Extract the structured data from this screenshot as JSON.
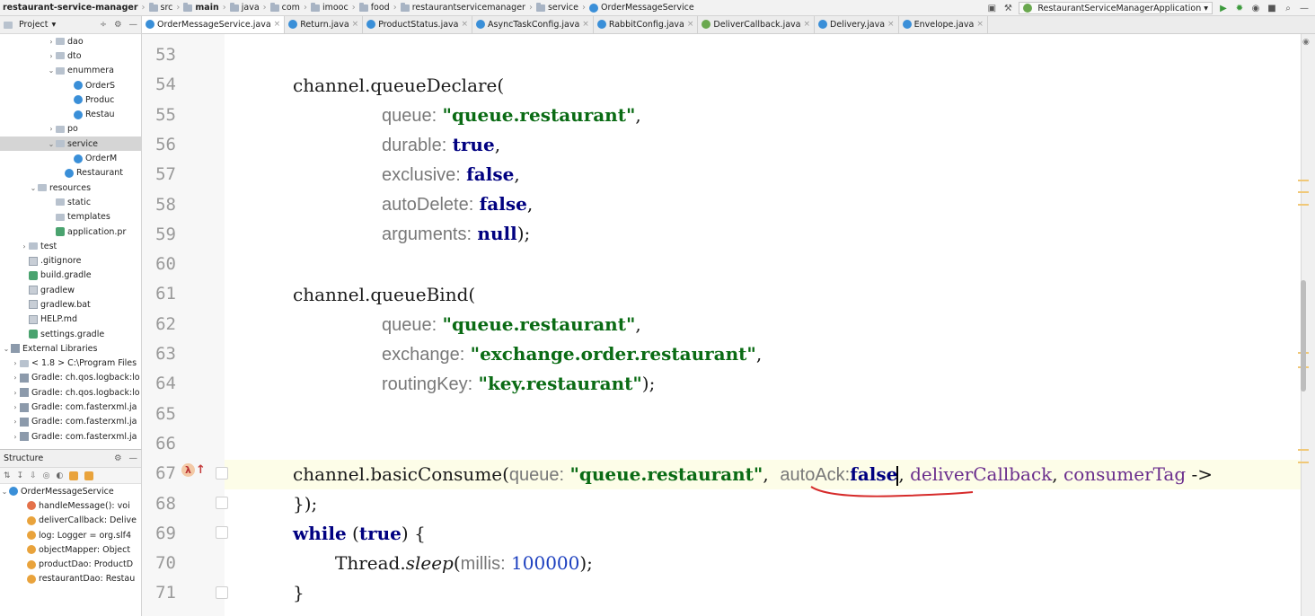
{
  "breadcrumb": {
    "items": [
      "restaurant-service-manager",
      "src",
      "main",
      "java",
      "com",
      "imooc",
      "food",
      "restaurantservicemanager",
      "service",
      "OrderMessageService"
    ]
  },
  "toolbar": {
    "run_config": "RestaurantServiceManagerApplication"
  },
  "project": {
    "header": "Project",
    "tree": [
      {
        "label": "dao",
        "indent": 5,
        "arrow": "›",
        "icon": "folder"
      },
      {
        "label": "dto",
        "indent": 5,
        "arrow": "›",
        "icon": "folder"
      },
      {
        "label": "enummera",
        "indent": 5,
        "arrow": "⌄",
        "icon": "folder"
      },
      {
        "label": "OrderS",
        "indent": 7,
        "arrow": "",
        "icon": "enum"
      },
      {
        "label": "Produc",
        "indent": 7,
        "arrow": "",
        "icon": "enum"
      },
      {
        "label": "Restau",
        "indent": 7,
        "arrow": "",
        "icon": "enum"
      },
      {
        "label": "po",
        "indent": 5,
        "arrow": "›",
        "icon": "folder"
      },
      {
        "label": "service",
        "indent": 5,
        "arrow": "⌄",
        "icon": "folder",
        "selected": true
      },
      {
        "label": "OrderM",
        "indent": 7,
        "arrow": "",
        "icon": "class"
      },
      {
        "label": "Restaurant",
        "indent": 6,
        "arrow": "",
        "icon": "class"
      },
      {
        "label": "resources",
        "indent": 3,
        "arrow": "⌄",
        "icon": "folder"
      },
      {
        "label": "static",
        "indent": 5,
        "arrow": "",
        "icon": "folder"
      },
      {
        "label": "templates",
        "indent": 5,
        "arrow": "",
        "icon": "folder"
      },
      {
        "label": "application.pr",
        "indent": 5,
        "arrow": "",
        "icon": "gradle"
      },
      {
        "label": "test",
        "indent": 2,
        "arrow": "›",
        "icon": "folder"
      },
      {
        "label": ".gitignore",
        "indent": 2,
        "arrow": "",
        "icon": "file"
      },
      {
        "label": "build.gradle",
        "indent": 2,
        "arrow": "",
        "icon": "gradle"
      },
      {
        "label": "gradlew",
        "indent": 2,
        "arrow": "",
        "icon": "file"
      },
      {
        "label": "gradlew.bat",
        "indent": 2,
        "arrow": "",
        "icon": "file"
      },
      {
        "label": "HELP.md",
        "indent": 2,
        "arrow": "",
        "icon": "file"
      },
      {
        "label": "settings.gradle",
        "indent": 2,
        "arrow": "",
        "icon": "gradle"
      },
      {
        "label": "External Libraries",
        "indent": 0,
        "arrow": "⌄",
        "icon": "lib"
      },
      {
        "label": "< 1.8 >  C:\\Program Files",
        "indent": 1,
        "arrow": "›",
        "icon": "folder"
      },
      {
        "label": "Gradle: ch.qos.logback:lo",
        "indent": 1,
        "arrow": "›",
        "icon": "lib"
      },
      {
        "label": "Gradle: ch.qos.logback:lo",
        "indent": 1,
        "arrow": "›",
        "icon": "lib"
      },
      {
        "label": "Gradle: com.fasterxml.ja",
        "indent": 1,
        "arrow": "›",
        "icon": "lib"
      },
      {
        "label": "Gradle: com.fasterxml.ja",
        "indent": 1,
        "arrow": "›",
        "icon": "lib"
      },
      {
        "label": "Gradle: com.fasterxml.ja",
        "indent": 1,
        "arrow": "›",
        "icon": "lib"
      }
    ]
  },
  "structure": {
    "header": "Structure",
    "root": "OrderMessageService",
    "items": [
      {
        "label": "handleMessage(): voi",
        "icon": "m"
      },
      {
        "label": "deliverCallback: Delive",
        "icon": "f"
      },
      {
        "label": "log: Logger = org.slf4",
        "icon": "f"
      },
      {
        "label": "objectMapper: Object",
        "icon": "f"
      },
      {
        "label": "productDao: ProductD",
        "icon": "f"
      },
      {
        "label": "restaurantDao: Restau",
        "icon": "f"
      }
    ]
  },
  "tabs": [
    {
      "label": "OrderMessageService.java",
      "active": true,
      "icon": "class"
    },
    {
      "label": "Return.java",
      "icon": "class"
    },
    {
      "label": "ProductStatus.java",
      "icon": "class"
    },
    {
      "label": "AsyncTaskConfig.java",
      "icon": "class"
    },
    {
      "label": "RabbitConfig.java",
      "icon": "class"
    },
    {
      "label": "DeliverCallback.java",
      "icon": "interface"
    },
    {
      "label": "Delivery.java",
      "icon": "class"
    },
    {
      "label": "Envelope.java",
      "icon": "class"
    }
  ],
  "editor": {
    "line_numbers": [
      "53",
      "54",
      "55",
      "56",
      "57",
      "58",
      "59",
      "60",
      "61",
      "62",
      "63",
      "64",
      "65",
      "66",
      "67",
      "68",
      "69",
      "70",
      "71"
    ],
    "code": {
      "l54": "channel.queueDeclare(",
      "l55_hint": "queue:",
      "l55_str": "\"queue.restaurant\"",
      "l55_tail": ",",
      "l56_hint": "durable:",
      "l56_val": "true",
      "l56_tail": ",",
      "l57_hint": "exclusive:",
      "l57_val": "false",
      "l57_tail": ",",
      "l58_hint": "autoDelete:",
      "l58_val": "false",
      "l58_tail": ",",
      "l59_hint": "arguments:",
      "l59_val": "null",
      "l59_tail": ");",
      "l61": "channel.queueBind(",
      "l62_hint": "queue:",
      "l62_str": "\"queue.restaurant\"",
      "l62_tail": ",",
      "l63_hint": "exchange:",
      "l63_str": "\"exchange.order.restaurant\"",
      "l63_tail": ",",
      "l64_hint": "routingKey:",
      "l64_str": "\"key.restaurant\"",
      "l64_tail": ");",
      "l67_head": "channel.basicConsume(",
      "l67_hint1": "queue:",
      "l67_str": "\"queue.restaurant\"",
      "l67_sep": ",",
      "l67_hint2": "autoAck:",
      "l67_val": "false",
      "l67_mid": ",",
      "l67_var1": "deliverCallback",
      "l67_comma": ",",
      "l67_var2": "consumerTag",
      "l67_arrow": "->",
      "l68": "});",
      "l69_kw": "while",
      "l69_open": "(",
      "l69_val": "true",
      "l69_close": ") {",
      "l70_head": "Thread.",
      "l70_method": "sleep",
      "l70_open": "(",
      "l70_hint": "millis:",
      "l70_num": "100000",
      "l70_tail": ");",
      "l71": "}"
    }
  },
  "colors": {
    "string": "#0a6b14",
    "keyword": "#000080",
    "hint": "#787878",
    "annotation_underline": "#d62b2b"
  }
}
